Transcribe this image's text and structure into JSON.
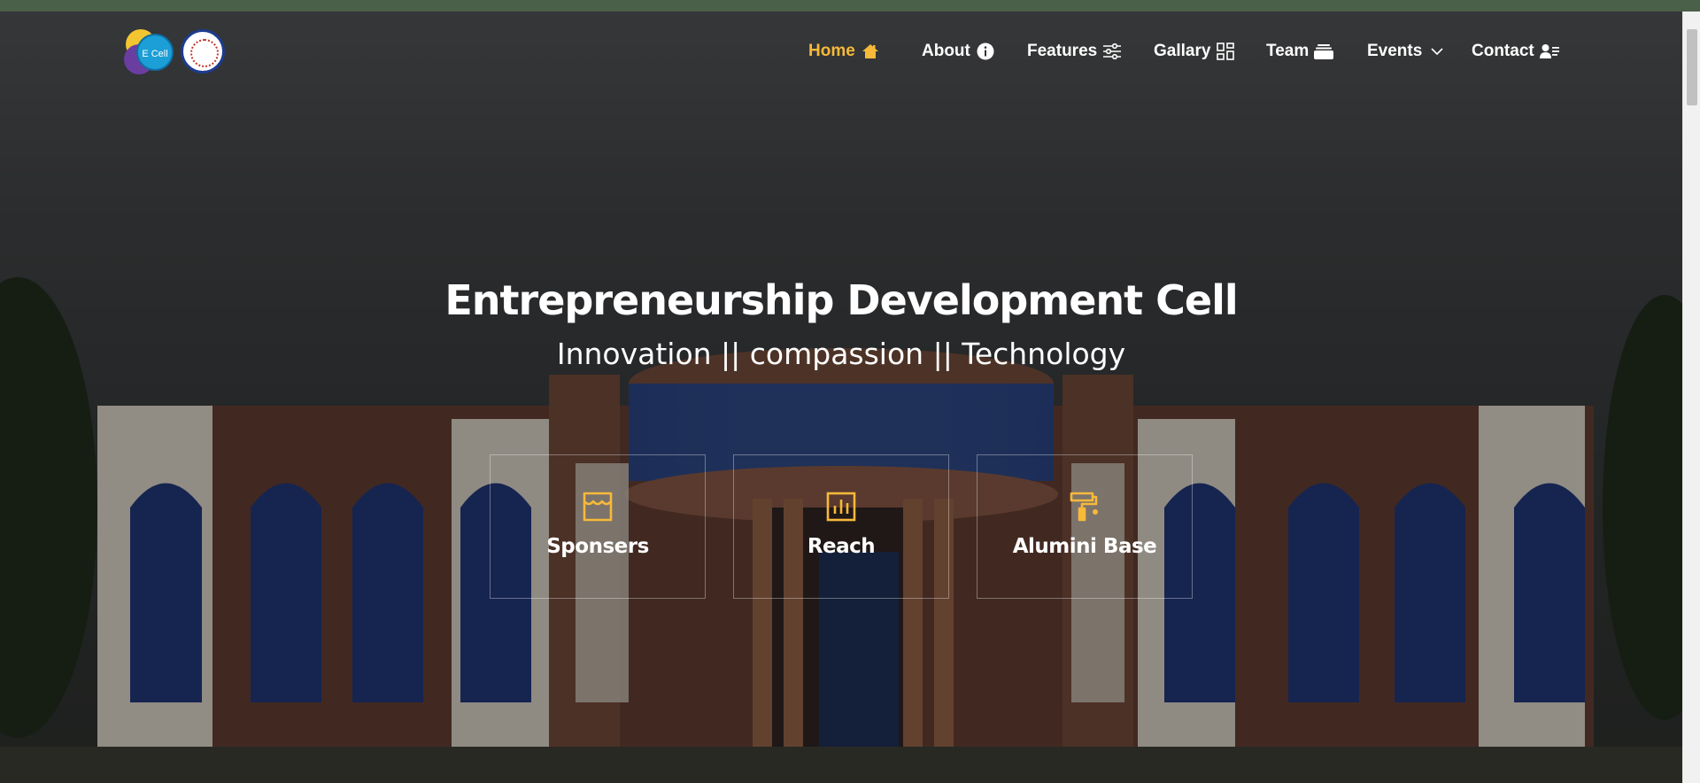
{
  "header": {
    "logos": [
      "ecell-logo",
      "college-seal-logo"
    ],
    "logo_text": "E Cell",
    "nav": [
      {
        "label": "Home",
        "icon": "home-icon",
        "active": true
      },
      {
        "label": "About",
        "icon": "info-icon",
        "active": false
      },
      {
        "label": "Features",
        "icon": "sliders-icon",
        "active": false
      },
      {
        "label": "Gallary",
        "icon": "grid-icon",
        "active": false
      },
      {
        "label": "Team",
        "icon": "stack-icon",
        "active": false
      },
      {
        "label": "Events",
        "icon": "chevron-down-icon",
        "active": false
      },
      {
        "label": "Contact",
        "icon": "contact-icon",
        "active": false
      }
    ]
  },
  "hero": {
    "title": "Entrepreneurship Development Cell",
    "subtitle": "Innovation || compassion || Technology"
  },
  "features": [
    {
      "label": "Sponsers",
      "icon": "store-icon"
    },
    {
      "label": "Reach",
      "icon": "bar-chart-icon"
    },
    {
      "label": "Alumini Base",
      "icon": "paint-roller-icon"
    }
  ],
  "colors": {
    "accent": "#f7b93a",
    "text": "#ffffff",
    "top_strip": "#4a6048"
  }
}
